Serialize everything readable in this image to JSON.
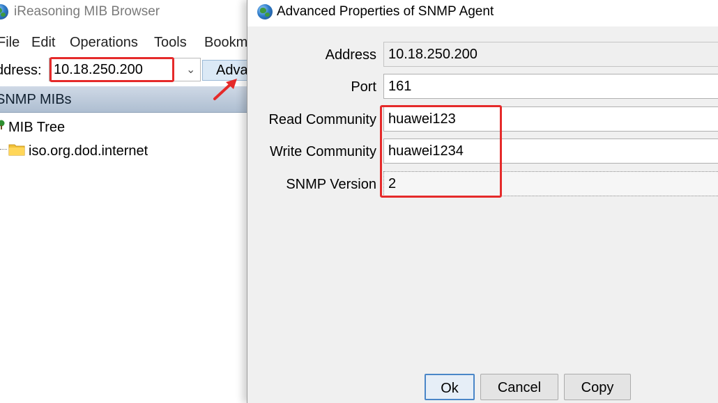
{
  "main_window": {
    "title": "iReasoning MIB Browser",
    "menu": [
      "File",
      "Edit",
      "Operations",
      "Tools",
      "Bookm"
    ],
    "address_label": "ddress:",
    "address_value": "10.18.250.200",
    "advanced_button": "Adva",
    "panel_title": "SNMP MIBs",
    "tree_root": "MIB Tree",
    "tree_child": "iso.org.dod.internet"
  },
  "dialog": {
    "title": "Advanced Properties of SNMP Agent",
    "fields": {
      "address_label": "Address",
      "address_value": "10.18.250.200",
      "port_label": "Port",
      "port_value": "161",
      "read_label": "Read Community",
      "read_value": "huawei123",
      "write_label": "Write Community",
      "write_value": "huawei1234",
      "version_label": "SNMP Version",
      "version_value": "2"
    },
    "buttons": {
      "ok": "Ok",
      "cancel": "Cancel",
      "copy": "Copy"
    }
  },
  "icons": {
    "app": "globe-icon",
    "tree_root": "tree-icon",
    "tree_child": "folder-icon",
    "dropdown": "chevron-down-icon",
    "annotation": "red-arrow-icon"
  },
  "colors": {
    "highlight": "#e52a2a",
    "panel_header": "#b8c6d7",
    "dialog_bg": "#f0f0f0",
    "default_button_border": "#4a86c8"
  }
}
